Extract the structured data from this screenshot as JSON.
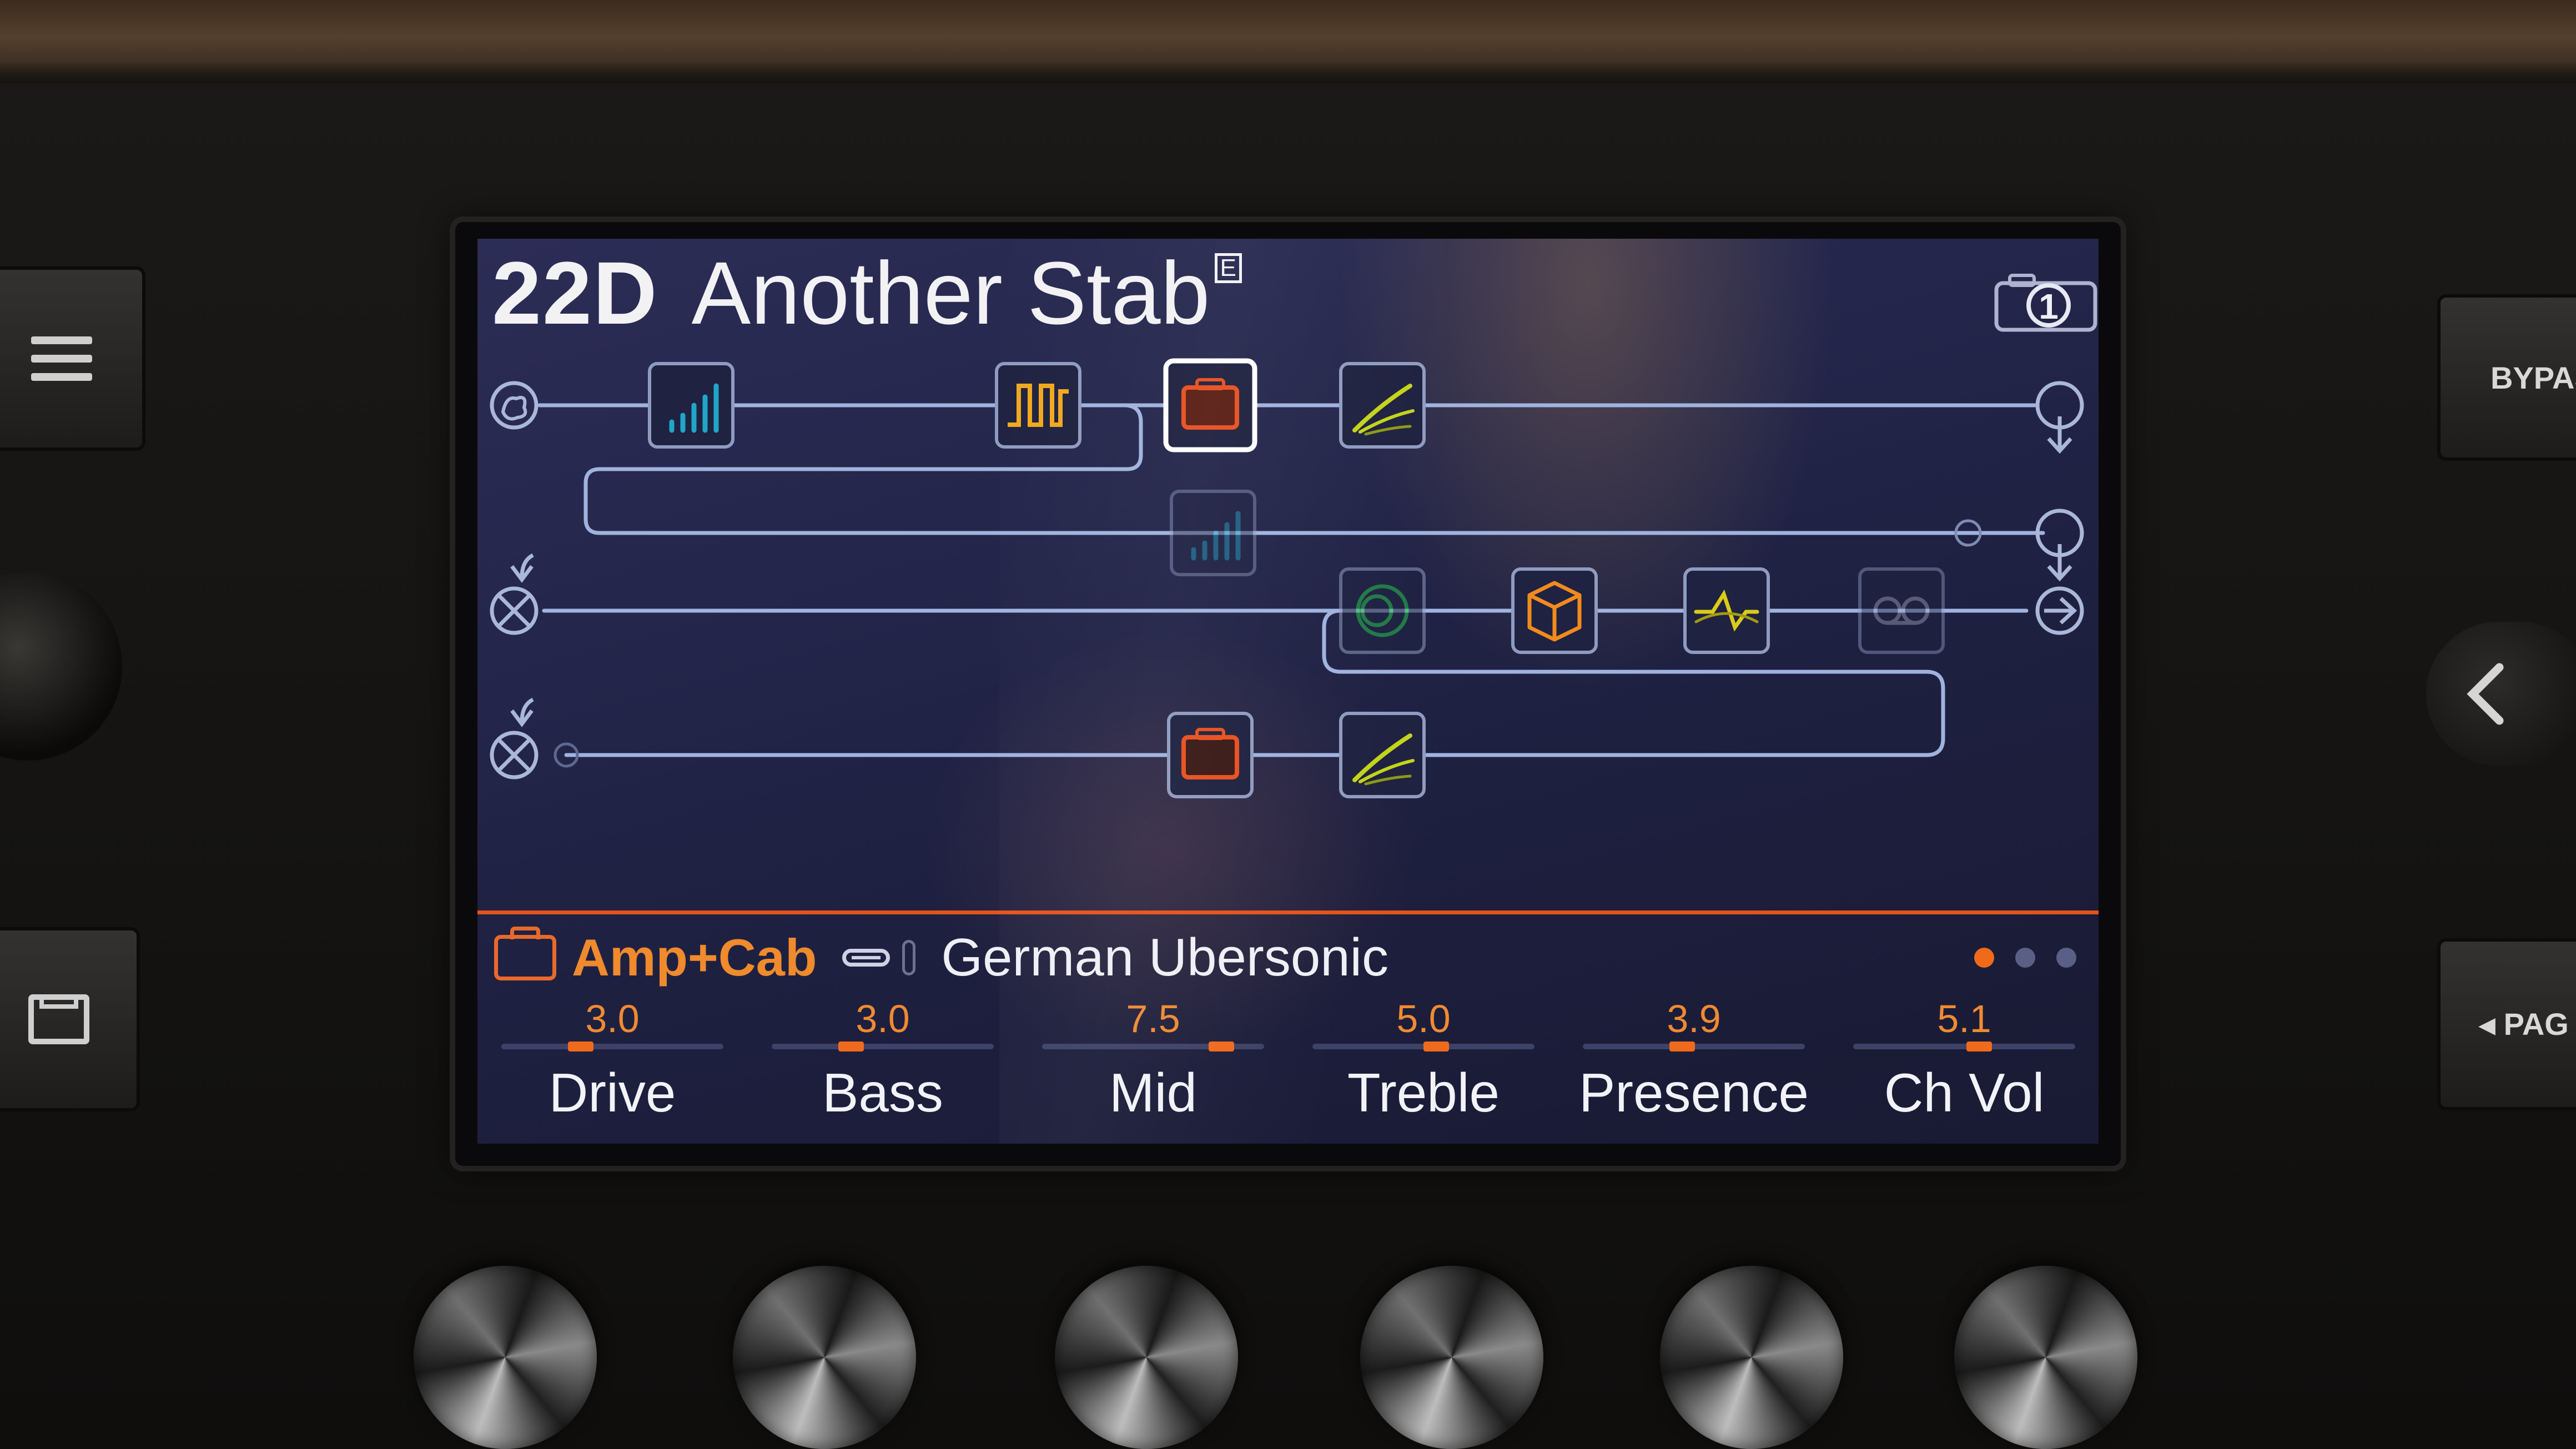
{
  "preset": {
    "number": "22D",
    "name": "Another Stab",
    "flag": "E",
    "snapshot": "1"
  },
  "signal_flow": {
    "path1": {
      "input_icon": "guitar-input-icon",
      "blocks": [
        {
          "name": "eq-graphic-icon",
          "color": "#1fa6c8",
          "active": true
        },
        {
          "name": "dynamics-gate-icon",
          "color": "#f0a81e",
          "active": true
        },
        {
          "name": "amp-icon",
          "color": "#e8501f",
          "active": true,
          "selected": true
        },
        {
          "name": "cab-icon",
          "color": "#c4d41a",
          "active": true
        }
      ],
      "split_block": {
        "name": "eq-graphic-icon",
        "color": "#1fa6c8",
        "active": false
      }
    },
    "path2": {
      "blocks": [
        {
          "name": "modulation-icon",
          "color": "#25c04a",
          "active": false
        },
        {
          "name": "delay-box-icon",
          "color": "#f28a1e",
          "active": true
        },
        {
          "name": "filter-wave-icon",
          "color": "#d9cc1a",
          "active": true
        },
        {
          "name": "looper-icon",
          "color": "#a0a3b8",
          "active": false
        },
        {
          "name": "amp-icon",
          "color": "#e8501f",
          "active": true
        },
        {
          "name": "cab-icon",
          "color": "#c4d41a",
          "active": true
        }
      ]
    }
  },
  "selected_block": {
    "category": "Amp+Cab",
    "model": "German Ubersonic",
    "category_color": "#ef8a2d"
  },
  "pages": {
    "count": 3,
    "current": 1
  },
  "parameters": [
    {
      "label": "Drive",
      "value": "3.0",
      "level": 0.3
    },
    {
      "label": "Bass",
      "value": "3.0",
      "level": 0.3
    },
    {
      "label": "Mid",
      "value": "7.5",
      "level": 0.75
    },
    {
      "label": "Treble",
      "value": "5.0",
      "level": 0.5
    },
    {
      "label": "Presence",
      "value": "3.9",
      "level": 0.39
    },
    {
      "label": "Ch Vol",
      "value": "5.1",
      "level": 0.51
    }
  ],
  "hardware": {
    "bypass_label": "BYPAS",
    "page_label": "◂ PAG"
  }
}
